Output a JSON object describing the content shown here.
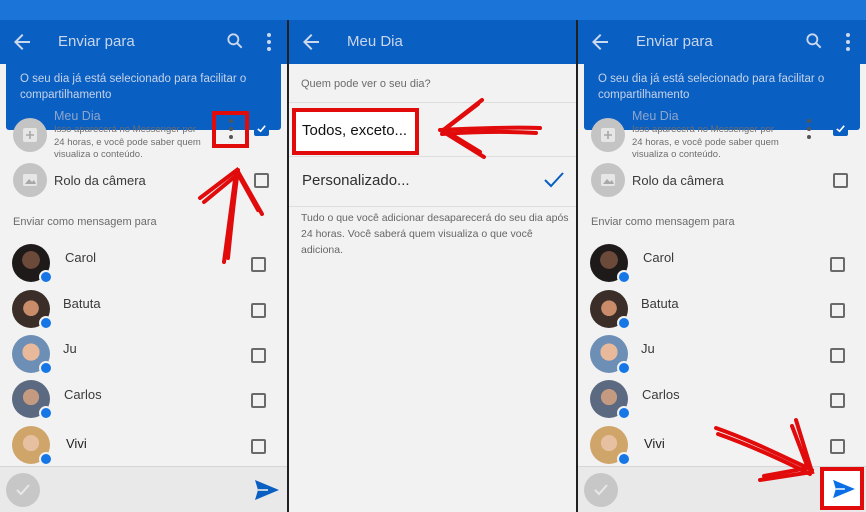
{
  "screens": {
    "left": {
      "title": "Enviar para",
      "banner": "O seu dia já está selecionado para facilitar o compartilhamento",
      "story_title": "Meu Dia",
      "story_desc": "Isso aparecerá no Messenger por 24 horas, e você pode saber quem visualiza o conteúdo.",
      "camera_roll": "Rolo da câmera",
      "section": "Enviar como mensagem para",
      "contacts": [
        "Carol",
        "Batuta",
        "Ju",
        "Carlos",
        "Vivi"
      ]
    },
    "middle": {
      "title": "Meu Dia",
      "question": "Quem pode ver o seu dia?",
      "options": [
        "Todos, exceto...",
        "Personalizado..."
      ],
      "note": "Tudo o que você adicionar desaparecerá do seu dia após 24 horas. Você saberá quem visualiza o que você adiciona."
    },
    "right": {
      "title": "Enviar para",
      "banner": "O seu dia já está selecionado para facilitar o compartilhamento",
      "story_title": "Meu Dia",
      "story_desc": "Isso aparecerá no Messenger por 24 horas, e você pode saber quem visualiza o conteúdo.",
      "camera_roll": "Rolo da câmera",
      "section": "Enviar como mensagem para",
      "contacts": [
        "Carol",
        "Batuta",
        "Ju",
        "Carlos",
        "Vivi"
      ]
    }
  },
  "icons": {
    "back": "back-arrow-icon",
    "search": "search-icon",
    "menu": "more-vert-icon",
    "send": "send-icon",
    "check": "check-icon",
    "messenger": "messenger-badge-icon"
  },
  "colors": {
    "accent": "#0a5fc2",
    "annotation": "#e10b0b",
    "background": "#f2f2f2"
  }
}
